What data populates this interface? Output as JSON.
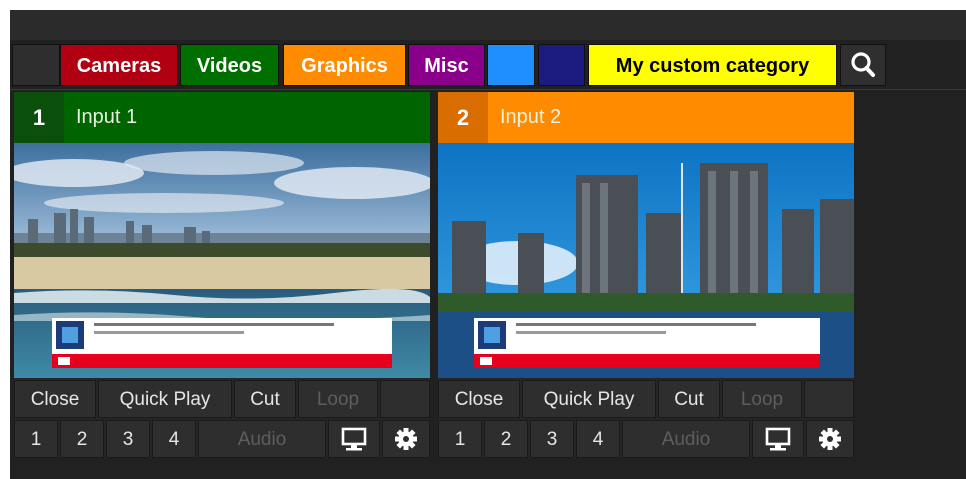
{
  "categories": [
    {
      "label": "",
      "bg": "#2e2e2e",
      "fg": "#ffffff"
    },
    {
      "label": "Cameras",
      "bg": "#b00012",
      "fg": "#ffffff"
    },
    {
      "label": "Videos",
      "bg": "#006f00",
      "fg": "#ffffff"
    },
    {
      "label": "Graphics",
      "bg": "#ff8c00",
      "fg": "#ffffff"
    },
    {
      "label": "Misc",
      "bg": "#8a008a",
      "fg": "#ffffff"
    },
    {
      "label": "",
      "bg": "#1f8fff",
      "fg": "#ffffff"
    },
    {
      "label": "",
      "bg": "#1c1c80",
      "fg": "#ffffff"
    },
    {
      "label": "My custom category",
      "bg": "#ffff00",
      "fg": "#000000"
    }
  ],
  "search": {
    "icon": "search-icon"
  },
  "inputs": [
    {
      "number": "1",
      "title": "Input 1",
      "header_color": "#006400",
      "number_bg": "#0a4f0a",
      "buttons": {
        "close": "Close",
        "quick_play": "Quick Play",
        "cut": "Cut",
        "loop": "Loop",
        "ov1": "1",
        "ov2": "2",
        "ov3": "3",
        "ov4": "4",
        "audio": "Audio"
      },
      "icons": {
        "monitor": "monitor-icon",
        "settings": "gear-icon"
      }
    },
    {
      "number": "2",
      "title": "Input 2",
      "header_color": "#ff8c00",
      "number_bg": "#d96d00",
      "buttons": {
        "close": "Close",
        "quick_play": "Quick Play",
        "cut": "Cut",
        "loop": "Loop",
        "ov1": "1",
        "ov2": "2",
        "ov3": "3",
        "ov4": "4",
        "audio": "Audio"
      },
      "icons": {
        "monitor": "monitor-icon",
        "settings": "gear-icon"
      }
    }
  ]
}
